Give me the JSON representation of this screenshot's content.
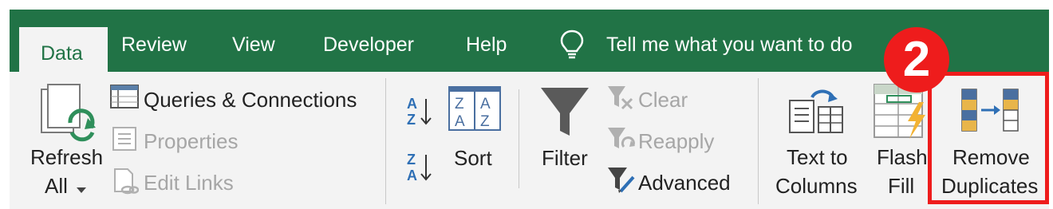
{
  "tabs": {
    "data": "Data",
    "review": "Review",
    "view": "View",
    "developer": "Developer",
    "help": "Help",
    "tell_me": "Tell me what you want to do"
  },
  "ribbon": {
    "refresh_line1": "Refresh",
    "refresh_line2": "All",
    "queries": "Queries & Connections",
    "properties": "Properties",
    "edit_links": "Edit Links",
    "sort": "Sort",
    "filter": "Filter",
    "clear": "Clear",
    "reapply": "Reapply",
    "advanced": "Advanced",
    "text_to_line1": "Text to",
    "text_to_line2": "Columns",
    "flash_line1": "Flash",
    "flash_line2": "Fill",
    "remove_line1": "Remove",
    "remove_line2": "Duplicates"
  },
  "annotation": {
    "step": "2"
  },
  "colors": {
    "tab_bar": "#217346",
    "ribbon": "#f3f3f3",
    "highlight": "#ee1c1c"
  }
}
